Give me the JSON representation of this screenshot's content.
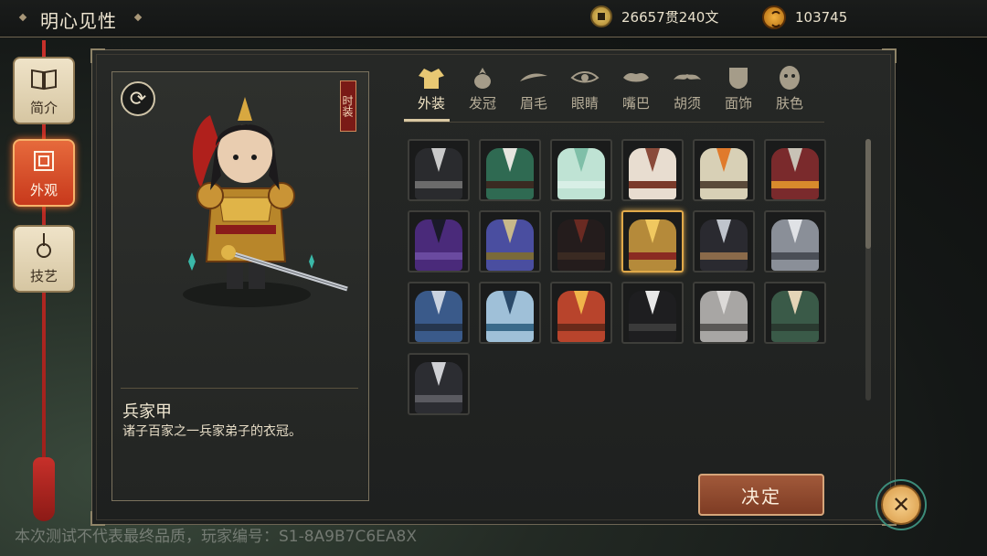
{
  "header": {
    "title": "明心见性",
    "currency_amount": "26657贯240文",
    "token_amount": "103745"
  },
  "sidebar": {
    "items": [
      {
        "label": "简介",
        "icon": "book-icon"
      },
      {
        "label": "外观",
        "icon": "appearance-icon",
        "active": true
      },
      {
        "label": "技艺",
        "icon": "lute-icon"
      }
    ]
  },
  "character": {
    "tag": "时装",
    "item_name": "兵家甲",
    "item_desc": "诸子百家之一兵家弟子的衣冠。"
  },
  "tabs": [
    {
      "label": "外装",
      "icon": "robe-icon",
      "active": true
    },
    {
      "label": "发冠",
      "icon": "hair-crown-icon"
    },
    {
      "label": "眉毛",
      "icon": "eyebrow-icon"
    },
    {
      "label": "眼睛",
      "icon": "eye-icon"
    },
    {
      "label": "嘴巴",
      "icon": "mouth-icon"
    },
    {
      "label": "胡须",
      "icon": "mustache-icon"
    },
    {
      "label": "面饰",
      "icon": "mask-icon"
    },
    {
      "label": "肤色",
      "icon": "face-icon"
    }
  ],
  "costumes": [
    {
      "robe": "#2a2b2e",
      "collar": "#c9c9c9",
      "belt": "#6b6b6b"
    },
    {
      "robe": "#2f6a52",
      "collar": "#e6e6e0",
      "belt": "#3a2a22"
    },
    {
      "robe": "#bfe3d4",
      "collar": "#7fbfa8",
      "belt": "#d8efe6"
    },
    {
      "robe": "#e8ddd0",
      "collar": "#8a4a3a",
      "belt": "#7a3a2a"
    },
    {
      "robe": "#d8d0b6",
      "collar": "#e07a2c",
      "belt": "#5a4a3a"
    },
    {
      "robe": "#7a2a2c",
      "collar": "#c8c2b6",
      "belt": "#d88a2c"
    },
    {
      "robe": "#4a2a7a",
      "collar": "#1a1a2a",
      "belt": "#6a4aa0"
    },
    {
      "robe": "#4a4ea0",
      "collar": "#c8b88a",
      "belt": "#7a6a3a"
    },
    {
      "robe": "#241c1c",
      "collar": "#6a2a22",
      "belt": "#3a2a22"
    },
    {
      "robe": "#b58a3a",
      "collar": "#f0c860",
      "belt": "#8a2a22",
      "selected": true
    },
    {
      "robe": "#2a2a30",
      "collar": "#bfc4cc",
      "belt": "#8a6a4a"
    },
    {
      "robe": "#8a8f98",
      "collar": "#e0e2e6",
      "belt": "#4a4e56"
    },
    {
      "robe": "#3a5a8a",
      "collar": "#c9d2e0",
      "belt": "#26364e"
    },
    {
      "robe": "#9fc0d8",
      "collar": "#2a4a6a",
      "belt": "#3a6a8a"
    },
    {
      "robe": "#b8442c",
      "collar": "#f0b44a",
      "belt": "#6a2a1a"
    },
    {
      "robe": "#1e1e20",
      "collar": "#e8e8e8",
      "belt": "#3a3a3a"
    },
    {
      "robe": "#a8a6a4",
      "collar": "#dcdad8",
      "belt": "#5a5856"
    },
    {
      "robe": "#3a5a48",
      "collar": "#e4d4b6",
      "belt": "#2a3a30"
    },
    {
      "robe": "#2c2d32",
      "collar": "#cfd0d4",
      "belt": "#5a5a60"
    }
  ],
  "buttons": {
    "confirm": "决定",
    "close_icon": "close-icon"
  },
  "watermark": "本次测试不代表最终品质，玩家编号：S1-8A9B7C6EA8X",
  "colors": {
    "accent": "#e0a94a",
    "active_tab": "#c8391c",
    "confirm_button": "#8e4a2e"
  }
}
